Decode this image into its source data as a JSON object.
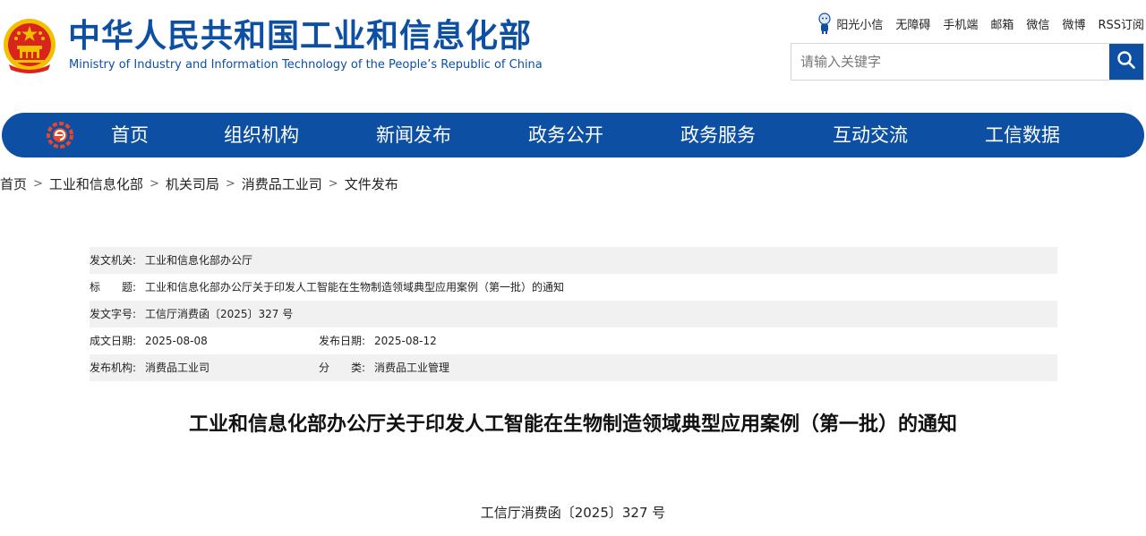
{
  "header": {
    "title_cn": "中华人民共和国工业和信息化部",
    "title_en": "Ministry of Industry and Information Technology of the People’s Republic of China",
    "links": [
      "阳光小信",
      "无障碍",
      "手机端",
      "邮箱",
      "微信",
      "微博",
      "RSS订阅"
    ],
    "search_placeholder": "请输入关键字"
  },
  "nav": {
    "items": [
      "首页",
      "组织机构",
      "新闻发布",
      "政务公开",
      "政务服务",
      "互动交流",
      "工信数据"
    ]
  },
  "breadcrumb": [
    "首页",
    "工业和信息化部",
    "机关司局",
    "消费品工业司",
    "文件发布"
  ],
  "meta": {
    "issuer_label": "发文机关:",
    "issuer": "工业和信息化部办公厅",
    "title_label": "标　　题:",
    "title": "工业和信息化部办公厅关于印发人工智能在生物制造领域典型应用案例（第一批）的通知",
    "docno_label": "发文字号:",
    "docno": "工信厅消费函〔2025〕327 号",
    "written_date_label": "成文日期:",
    "written_date": "2025-08-08",
    "publish_date_label": "发布日期:",
    "publish_date": "2025-08-12",
    "org_label": "发布机构:",
    "org": "消费品工业司",
    "category_label": "分　　类:",
    "category": "消费品工业管理"
  },
  "document": {
    "title": "工业和信息化部办公厅关于印发人工智能在生物制造领域典型应用案例（第一批）的通知",
    "number": "工信厅消费函〔2025〕327 号"
  },
  "colors": {
    "brand_blue": "#0d50a3",
    "emblem_red": "#d8241c",
    "emblem_gold": "#f3c000"
  },
  "icons": [
    "national-emblem-icon",
    "mascot-icon",
    "search-icon",
    "nav-logo-icon",
    "chevron-right-icon"
  ]
}
